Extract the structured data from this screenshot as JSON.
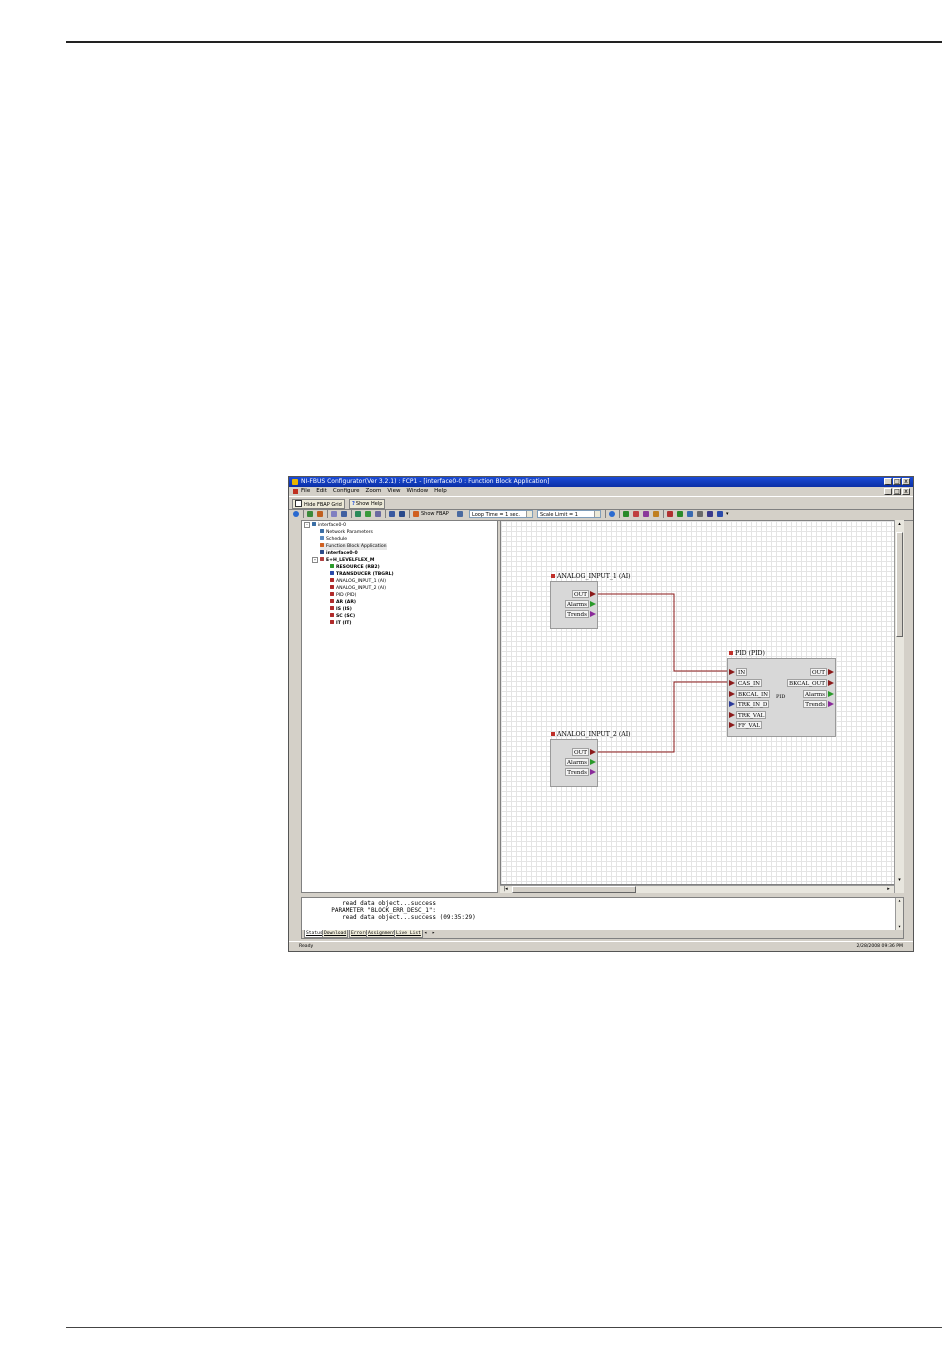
{
  "window": {
    "title": "NI-FBUS Configurator(Ver 3.2.1) : FCP1 - [interface0-0 : Function Block Application]",
    "controls": [
      "_",
      "□",
      "x"
    ]
  },
  "menu": {
    "items": [
      "File",
      "Edit",
      "Configure",
      "Zoom",
      "View",
      "Window",
      "Help"
    ],
    "mdi_controls": [
      "_",
      "□",
      "x"
    ]
  },
  "toolbar": {
    "hide_grid": "Hide FBAP Grid",
    "show_help": "Show Help",
    "show_fbap": "Show FBAP",
    "loop_time": "Loop Time = 1 sec.",
    "scale_limit": "Scale Limit = 1"
  },
  "tree": {
    "root": "interface0-0",
    "items": [
      {
        "label": "Network Parameters",
        "icon_color": "#3a6ea5"
      },
      {
        "label": "Schedule",
        "icon_color": "#5a8ac0"
      },
      {
        "label": "Function Block Application",
        "icon_color": "#d06020"
      },
      {
        "label": "interface0-0",
        "icon_color": "#2a4a8a"
      },
      {
        "label": "E+H_LEVELFLEX_M",
        "icon_color": "#b04040"
      }
    ],
    "blocks": [
      {
        "label": "RESOURCE (RB2)",
        "icon_color": "#2a9a2a",
        "bold": true
      },
      {
        "label": "TRANSDUCER (TBGRL)",
        "icon_color": "#2a4aaa",
        "bold": true
      },
      {
        "label": "ANALOG_INPUT_1 (AI)",
        "icon_color": "#b02a2a",
        "bold": false
      },
      {
        "label": "ANALOG_INPUT_2 (AI)",
        "icon_color": "#b02a2a",
        "bold": false
      },
      {
        "label": "PID (PID)",
        "icon_color": "#b02a2a",
        "bold": false
      },
      {
        "label": "AR (AR)",
        "icon_color": "#b02a2a",
        "bold": true
      },
      {
        "label": "IS (IS)",
        "icon_color": "#b02a2a",
        "bold": true
      },
      {
        "label": "SC (SC)",
        "icon_color": "#b02a2a",
        "bold": true
      },
      {
        "label": "IT (IT)",
        "icon_color": "#b02a2a",
        "bold": true
      }
    ]
  },
  "fbap": {
    "ai1": {
      "title": "ANALOG_INPUT_1 (AI)",
      "ports": [
        "OUT",
        "Alarms",
        "Trends"
      ]
    },
    "ai2": {
      "title": "ANALOG_INPUT_2 (AI)",
      "ports": [
        "OUT",
        "Alarms",
        "Trends"
      ]
    },
    "pid": {
      "title": "PID (PID)",
      "center": "PID",
      "inputs": [
        "IN",
        "CAS_IN",
        "BKCAL_IN",
        "TRK_IN_D",
        "TRK_VAL",
        "FF_VAL"
      ],
      "outputs": [
        "OUT",
        "BKCAL_OUT",
        "Alarms",
        "Trends"
      ]
    },
    "colors": {
      "wire": "#8b1a1a",
      "alarm_port": "#2a9a2a",
      "trend_port": "#8a2a9a",
      "trk_port": "#2a3a9a"
    }
  },
  "output": {
    "lines": [
      "          read data object...success",
      "       PARAMETER \"BLOCK_ERR_DESC_1\":",
      "          read data object...success (09:35:29)"
    ],
    "tabs": [
      "Status",
      "Download",
      "Errors",
      "Assignment",
      "Live List"
    ]
  },
  "status": {
    "left": "Ready",
    "right": "2/28/2008 09:36 PM"
  }
}
